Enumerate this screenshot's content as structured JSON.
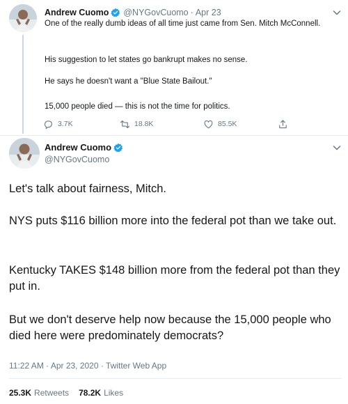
{
  "colors": {
    "verified": "#1da1f2",
    "text": "#14171a",
    "muted": "#657786",
    "border": "#e6ecf0"
  },
  "parent_tweet": {
    "author_name": "Andrew Cuomo",
    "handle": "@NYGovCuomo",
    "separator": "·",
    "date": "Apr 23",
    "paragraphs": [
      "One of the really dumb ideas of all time just came from Sen. Mitch McConnell.",
      "His suggestion to let states go bankrupt makes no sense.",
      "He says he doesn't want a \"Blue State Bailout.\"",
      "15,000 people died — this is not the time for politics."
    ],
    "actions": {
      "reply_count": "3.7K",
      "retweet_count": "18.8K",
      "like_count": "85.5K"
    },
    "icons": [
      "reply-icon",
      "retweet-icon",
      "like-icon",
      "share-icon",
      "verified-icon",
      "chevron-down-icon"
    ]
  },
  "main_tweet": {
    "author_name": "Andrew Cuomo",
    "handle": "@NYGovCuomo",
    "paragraphs": [
      "Let's talk about fairness, Mitch.",
      "NYS puts $116 billion more into the federal pot than we take out.",
      "Kentucky TAKES $148 billion more from the federal pot than they put in.",
      "But we don't deserve help now because the 15,000 people who died here were predominately democrats?"
    ],
    "timestamp": "11:22 AM · Apr 23, 2020 · ",
    "source_app": "Twitter Web App",
    "retweets_count": "25.3K",
    "retweets_label": "Retweets",
    "likes_count": "78.2K",
    "likes_label": "Likes"
  }
}
